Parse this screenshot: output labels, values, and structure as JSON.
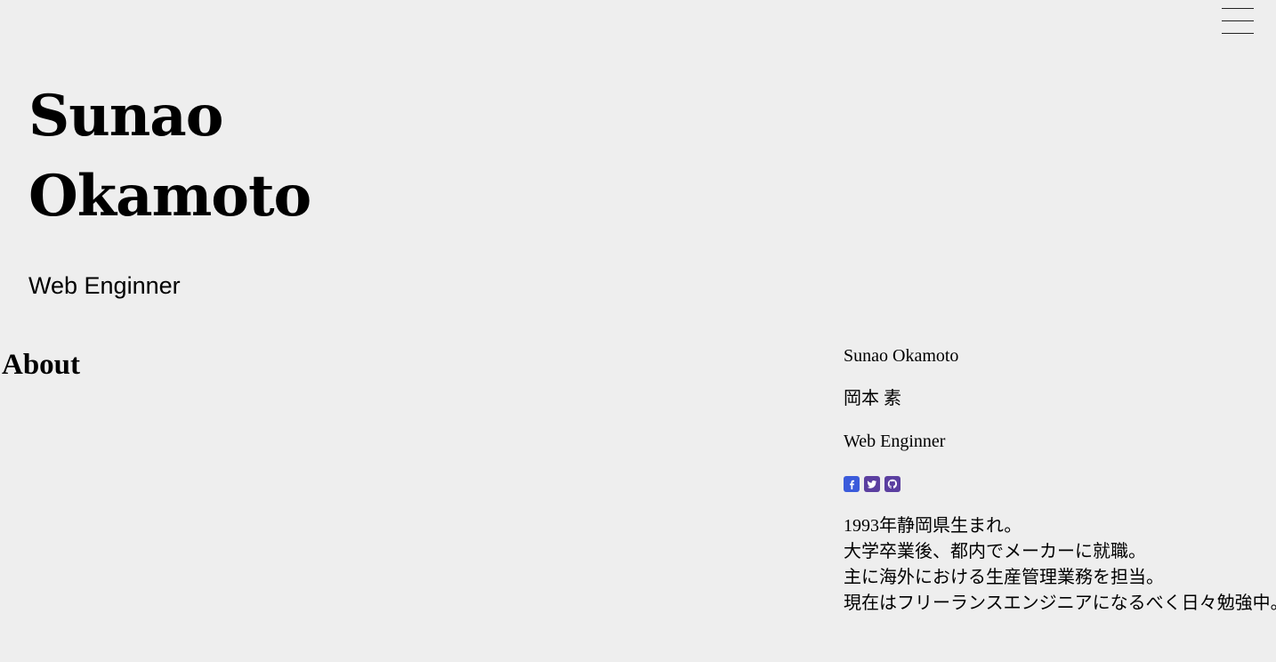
{
  "header": {
    "menu_icon": "hamburger-menu-icon"
  },
  "hero": {
    "first_name": "Sunao",
    "last_name": "Okamoto",
    "role": "Web Enginner"
  },
  "about": {
    "title": "About",
    "name_en": "Sunao Okamoto",
    "name_ja": "岡本 素",
    "role": "Web Enginner",
    "social": [
      {
        "icon": "facebook-icon",
        "color": "#3b5bdb"
      },
      {
        "icon": "twitter-icon",
        "color": "#5b3fa0"
      },
      {
        "icon": "github-icon",
        "color": "#5b3fa0"
      }
    ],
    "bio": [
      "1993年静岡県生まれ。",
      "大学卒業後、都内でメーカーに就職。",
      "主に海外における生産管理業務を担当。",
      "現在はフリーランスエンジニアになるべく日々勉強中。"
    ]
  }
}
